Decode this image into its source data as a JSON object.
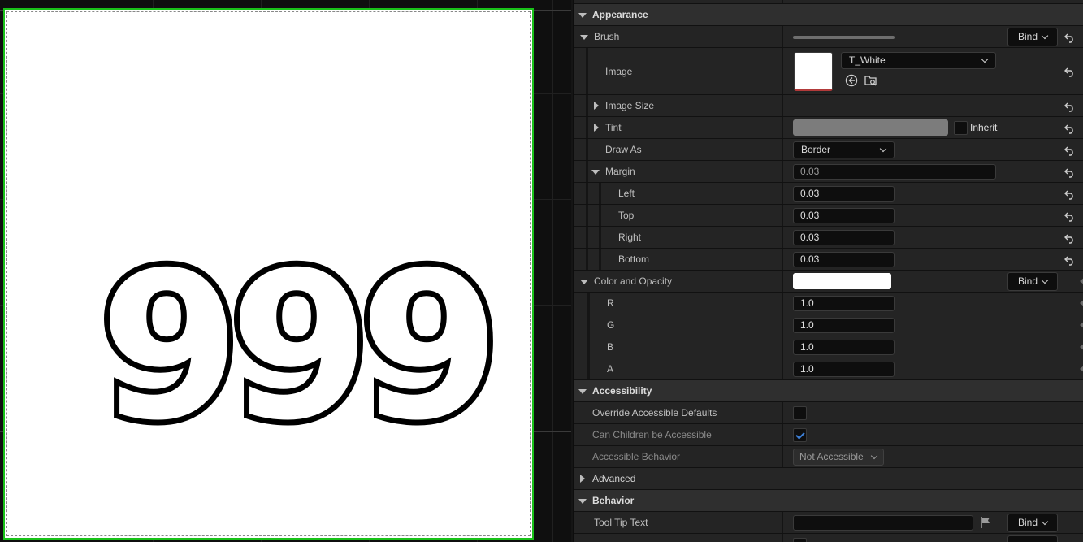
{
  "canvas": {
    "display_text": "999"
  },
  "sections": {
    "appearance": "Appearance",
    "accessibility": "Accessibility",
    "advanced": "Advanced",
    "behavior": "Behavior"
  },
  "brush": {
    "label": "Brush",
    "bind_label": "Bind",
    "image_label": "Image",
    "image_asset": "T_White",
    "image_size_label": "Image Size",
    "tint_label": "Tint",
    "inherit_label": "Inherit",
    "draw_as_label": "Draw As",
    "draw_as_value": "Border",
    "margin_label": "Margin",
    "margin_value": "0.03",
    "margin_left_label": "Left",
    "margin_left": "0.03",
    "margin_top_label": "Top",
    "margin_top": "0.03",
    "margin_right_label": "Right",
    "margin_right": "0.03",
    "margin_bottom_label": "Bottom",
    "margin_bottom": "0.03"
  },
  "color_opacity": {
    "label": "Color and Opacity",
    "bind_label": "Bind",
    "swatch_color": "#ffffff",
    "r_label": "R",
    "r": "1.0",
    "g_label": "G",
    "g": "1.0",
    "b_label": "B",
    "b": "1.0",
    "a_label": "A",
    "a": "1.0"
  },
  "accessibility": {
    "override_label": "Override Accessible Defaults",
    "children_label": "Can Children be Accessible",
    "behavior_label": "Accessible Behavior",
    "behavior_value": "Not Accessible"
  },
  "behavior": {
    "tooltip_label": "Tool Tip Text",
    "tooltip_value": "",
    "bind_label": "Bind"
  },
  "colors": {
    "selection_outline": "#19c219",
    "canvas_bg": "#ffffff",
    "tint_swatch": "#7c7c7c"
  }
}
